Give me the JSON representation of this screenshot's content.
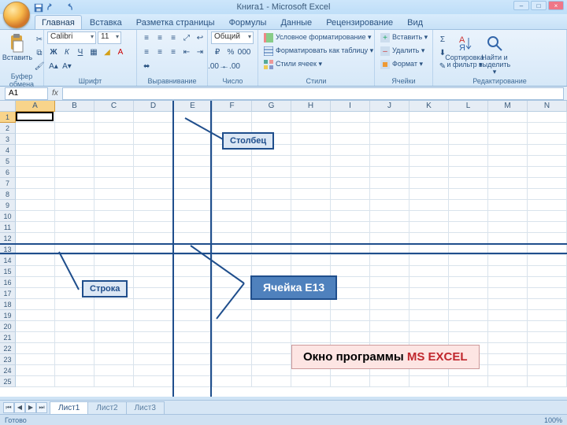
{
  "window": {
    "title": "Книга1 - Microsoft Excel"
  },
  "tabs": [
    "Главная",
    "Вставка",
    "Разметка страницы",
    "Формулы",
    "Данные",
    "Рецензирование",
    "Вид"
  ],
  "active_tab": 0,
  "ribbon": {
    "clipboard": {
      "label": "Буфер обмена",
      "paste": "Вставить"
    },
    "font": {
      "label": "Шрифт",
      "name": "Calibri",
      "size": "11"
    },
    "align": {
      "label": "Выравнивание"
    },
    "number": {
      "label": "Число",
      "format": "Общий"
    },
    "styles": {
      "label": "Стили",
      "cond": "Условное форматирование ▾",
      "table": "Форматировать как таблицу ▾",
      "cell": "Стили ячеек ▾"
    },
    "cells": {
      "label": "Ячейки",
      "insert": "Вставить ▾",
      "delete": "Удалить ▾",
      "format": "Формат ▾"
    },
    "editing": {
      "label": "Редактирование",
      "sort": "Сортировка и фильтр ▾",
      "find": "Найти и выделить ▾"
    }
  },
  "namebox": "A1",
  "columns": [
    "A",
    "B",
    "C",
    "D",
    "E",
    "F",
    "G",
    "H",
    "I",
    "J",
    "K",
    "L",
    "M",
    "N"
  ],
  "rows_count": 25,
  "selected_col": "A",
  "selected_row": 1,
  "highlight_col_index": 4,
  "highlight_row_index": 12,
  "annotations": {
    "column": "Столбец",
    "row": "Строка",
    "cell": "Ячейка Е13"
  },
  "caption": {
    "text": "Окно программы ",
    "app": "MS EXCEL"
  },
  "sheets": [
    "Лист1",
    "Лист2",
    "Лист3"
  ],
  "active_sheet": 0,
  "status": {
    "ready": "Готово",
    "zoom": "100%"
  }
}
